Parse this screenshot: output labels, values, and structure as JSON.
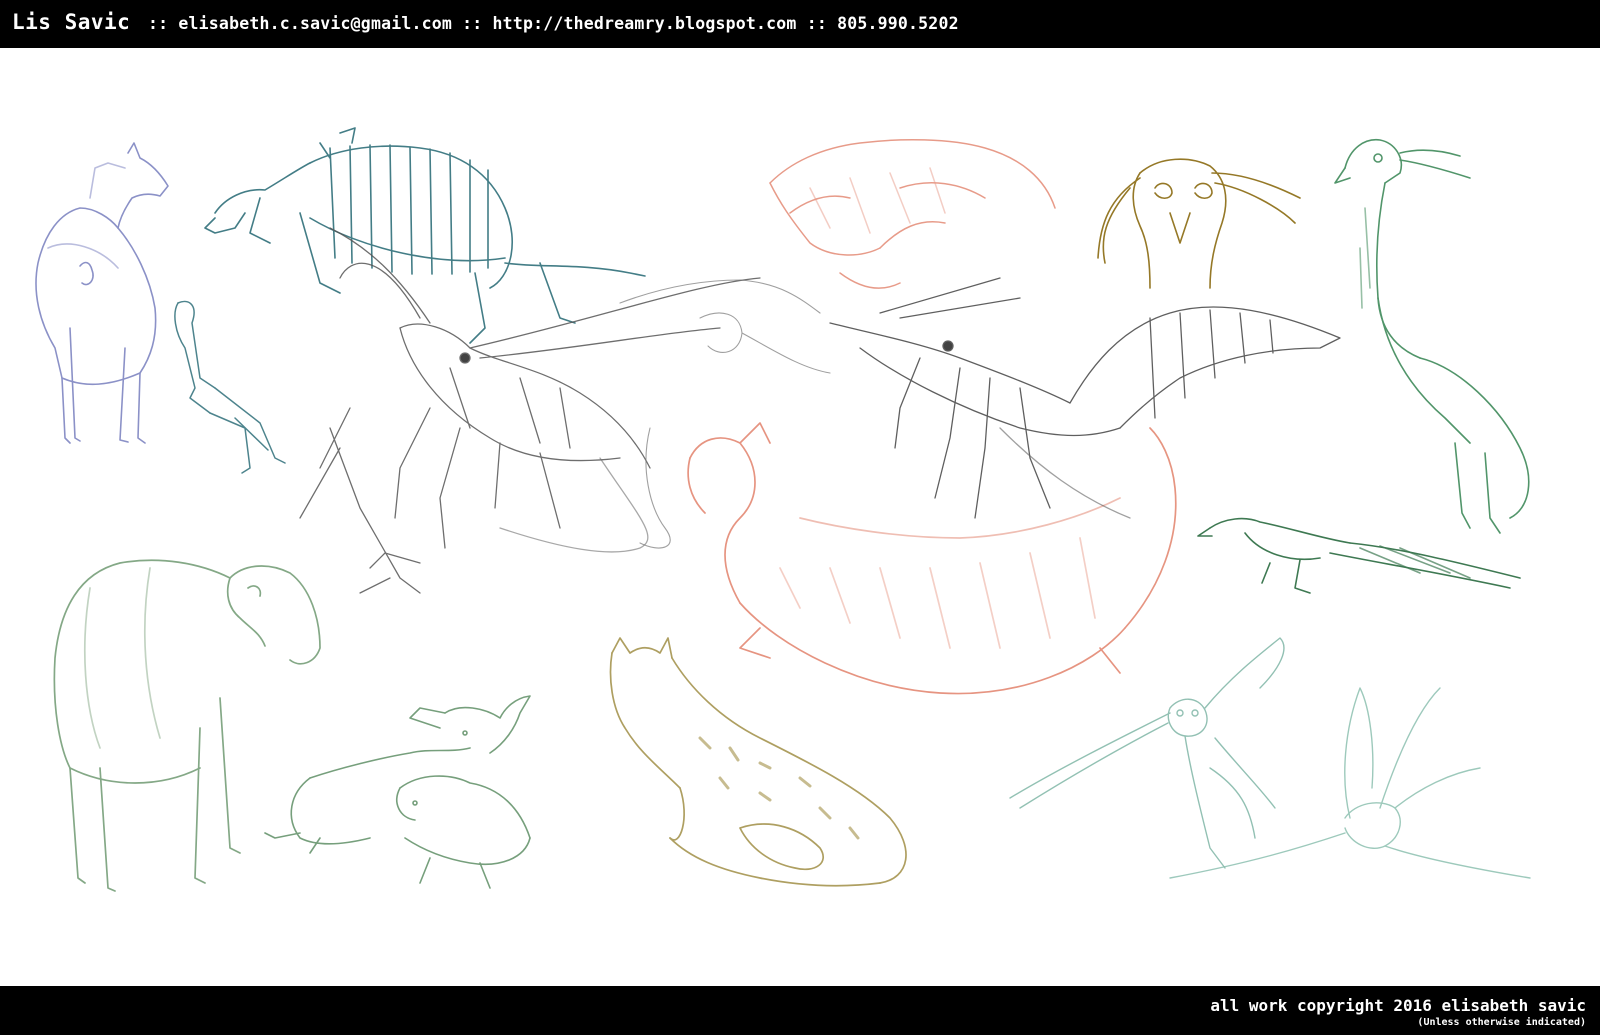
{
  "header": {
    "name": "Lis Savic",
    "contact": ":: elisabeth.c.savic@gmail.com :: http://thedreamry.blogspot.com :: 805.990.5202"
  },
  "artwork": {
    "sketch_colors": {
      "blue": "#7f86c2",
      "teal": "#2f6f7a",
      "salmon": "#e07a62",
      "graphite": "#555555",
      "ochre": "#8a6a10",
      "green": "#3f8a5a",
      "sage": "#6f9a72",
      "tan": "#a69550",
      "mint": "#7fb6a6"
    }
  },
  "footer": {
    "copyright": "all work copyright 2016 elisabeth savic",
    "note": "(Unless otherwise indicated)"
  }
}
